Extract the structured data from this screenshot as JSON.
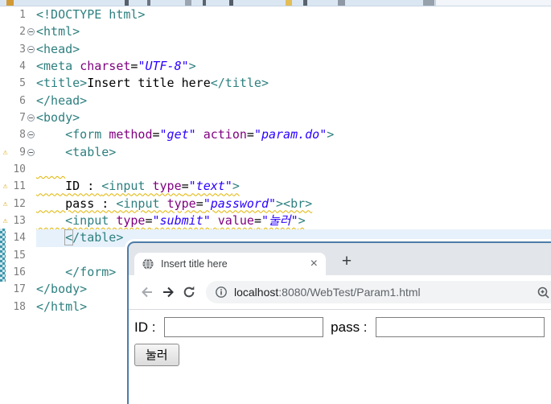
{
  "colors": {
    "tag": "#2e7f7f",
    "attr": "#7f007f",
    "value": "#2a00ff",
    "warning": "#e0b400",
    "currentLine": "#e6f1fb",
    "windowBorder": "#4d7ca8",
    "tabStrip": "#e2e5e9",
    "pill": "#f1f3f4",
    "urlDark": "#202124",
    "urlGray": "#5f6368"
  },
  "editor": {
    "lines": [
      {
        "num": "1",
        "segs": [
          [
            "tag",
            "<!DOCTYPE html>"
          ]
        ]
      },
      {
        "num": "2",
        "fold": true,
        "segs": [
          [
            "tag",
            "<html>"
          ]
        ]
      },
      {
        "num": "3",
        "fold": true,
        "segs": [
          [
            "tag",
            "<head>"
          ]
        ]
      },
      {
        "num": "4",
        "segs": [
          [
            "tag",
            "<meta "
          ],
          [
            "attr",
            "charset"
          ],
          [
            "eq",
            "="
          ],
          [
            "val",
            "\"UTF-8\""
          ],
          [
            "tag",
            ">"
          ]
        ]
      },
      {
        "num": "5",
        "segs": [
          [
            "tag",
            "<title>"
          ],
          [
            "plain",
            "Insert title here"
          ],
          [
            "tag",
            "</title>"
          ]
        ]
      },
      {
        "num": "6",
        "segs": [
          [
            "tag",
            "</head>"
          ]
        ]
      },
      {
        "num": "7",
        "fold": true,
        "segs": [
          [
            "tag",
            "<body>"
          ]
        ]
      },
      {
        "num": "8",
        "fold": true,
        "indent": 1,
        "segs": [
          [
            "tag",
            "<form "
          ],
          [
            "attr",
            "method"
          ],
          [
            "eq",
            "="
          ],
          [
            "val",
            "\"get\""
          ],
          [
            "plain",
            " "
          ],
          [
            "attr",
            "action"
          ],
          [
            "eq",
            "="
          ],
          [
            "val",
            "\"param.do\""
          ],
          [
            "tag",
            ">"
          ]
        ]
      },
      {
        "num": "9",
        "fold": true,
        "warn": true,
        "indent": 1,
        "segs": [
          [
            "tag",
            "<table>"
          ]
        ]
      },
      {
        "num": "10",
        "indent": 1,
        "squiggle": true,
        "segs": []
      },
      {
        "num": "11",
        "warn": true,
        "indent": 1,
        "squiggle": true,
        "segs": [
          [
            "plain",
            "ID : "
          ],
          [
            "tag",
            "<input "
          ],
          [
            "attr",
            "type"
          ],
          [
            "eq",
            "="
          ],
          [
            "val",
            "\"text\""
          ],
          [
            "tag",
            ">"
          ]
        ]
      },
      {
        "num": "12",
        "warn": true,
        "indent": 1,
        "squiggle": true,
        "segs": [
          [
            "plain",
            "pass : "
          ],
          [
            "tag",
            "<input "
          ],
          [
            "attr",
            "type"
          ],
          [
            "eq",
            "="
          ],
          [
            "val",
            "\"password\""
          ],
          [
            "tag",
            "><br>"
          ]
        ]
      },
      {
        "num": "13",
        "warn": true,
        "indent": 1,
        "squiggle": true,
        "segs": [
          [
            "tag",
            "<input "
          ],
          [
            "attr",
            "type"
          ],
          [
            "eq",
            "="
          ],
          [
            "val",
            "\"submit\""
          ],
          [
            "plain",
            " "
          ],
          [
            "attr",
            "value"
          ],
          [
            "eq",
            "="
          ],
          [
            "val",
            "\"눌러\""
          ],
          [
            "tag",
            ">"
          ]
        ]
      },
      {
        "num": "14",
        "indent": 1,
        "current": true,
        "segs": [
          [
            "tagbox",
            "<"
          ],
          [
            "tag",
            "/table>"
          ]
        ]
      },
      {
        "num": "15",
        "segs": []
      },
      {
        "num": "16",
        "indent": 1,
        "segs": [
          [
            "tag",
            "</form>"
          ]
        ]
      },
      {
        "num": "17",
        "segs": [
          [
            "tag",
            "</body>"
          ]
        ]
      },
      {
        "num": "18",
        "segs": [
          [
            "tag",
            "</html>"
          ]
        ]
      }
    ],
    "warning_icon": "⚠"
  },
  "browser": {
    "tab": {
      "title": "Insert title here",
      "close": "×",
      "new_tab": "+"
    },
    "url": {
      "host": "localhost",
      "rest": ":8080/WebTest/Param1.html"
    },
    "page": {
      "id_label": "ID : ",
      "pass_label": "pass : ",
      "submit_label": "눌러"
    }
  }
}
